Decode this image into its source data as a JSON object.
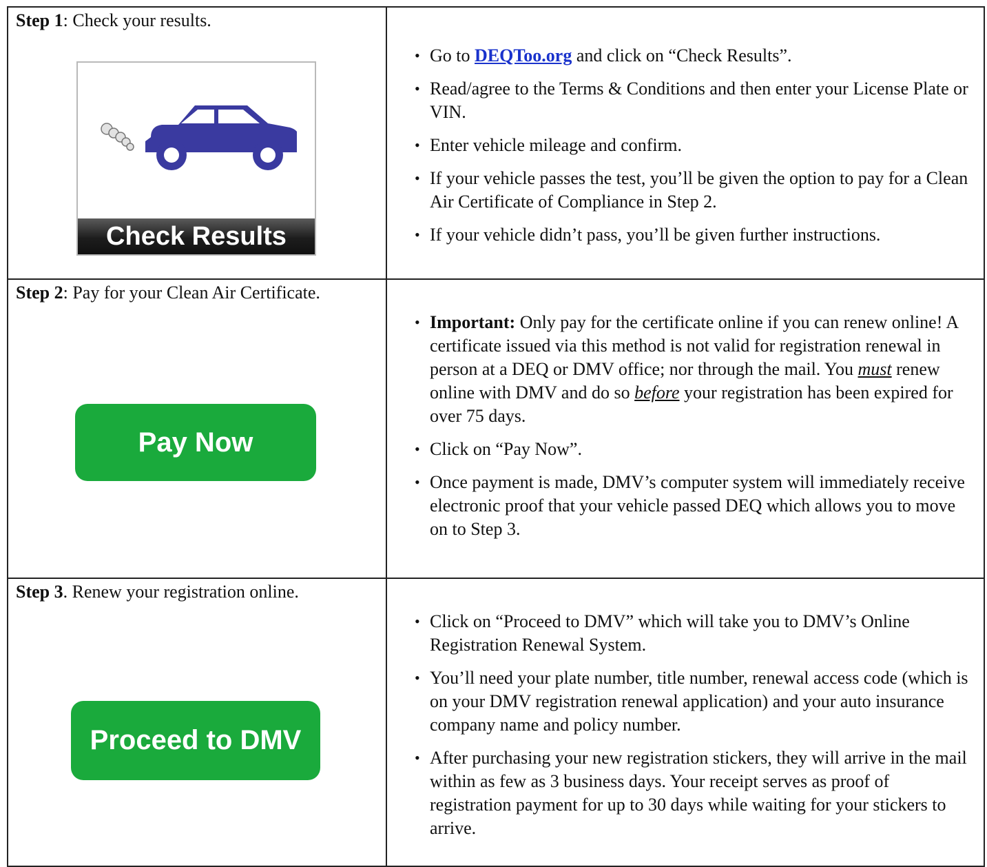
{
  "step1": {
    "heading_bold": "Step 1",
    "heading_rest": ": Check your results.",
    "card_label": "Check Results",
    "bullets": {
      "b1_pre": "Go to ",
      "b1_link": "DEQToo.org",
      "b1_post": " and click on “Check Results”.",
      "b2": "Read/agree to the Terms & Conditions and then enter your License Plate or VIN.",
      "b3": "Enter vehicle mileage and confirm.",
      "b4": "If your vehicle passes the test, you’ll be given the option to pay for a Clean Air Certificate of Compliance in Step 2.",
      "b5": "If your vehicle didn’t pass, you’ll be given further instructions."
    }
  },
  "step2": {
    "heading_bold": "Step 2",
    "heading_rest": ": Pay for your Clean Air Certificate.",
    "button_label": "Pay Now",
    "bullets": {
      "b1_bold": "Important:",
      "b1_a": " Only pay for the certificate online if you can renew online!  A certificate issued via this method is not valid for registration renewal in person at a DEQ or DMV office; nor through the mail.  You ",
      "b1_must": "must",
      "b1_b": " renew online with DMV and do so ",
      "b1_before": "before",
      "b1_c": " your registration has been expired for over 75 days.",
      "b2": "Click on “Pay Now”.",
      "b3": "Once payment is made, DMV’s computer system will immediately receive electronic proof that your vehicle passed DEQ which allows you to move on to Step 3."
    }
  },
  "step3": {
    "heading_bold": "Step 3",
    "heading_rest": ". Renew your registration online.",
    "button_label": "Proceed to DMV",
    "bullets": {
      "b1": "Click on “Proceed to DMV” which will take you to DMV’s Online Registration Renewal System.",
      "b2": "You’ll need your plate number, title number, renewal access code (which is on your DMV registration renewal application) and your auto insurance company name and policy number.",
      "b3": "After purchasing your new registration stickers, they will arrive in the mail within as few as 3 business days. Your receipt serves as proof of registration payment for up to 30 days while waiting for your stickers to arrive."
    }
  },
  "colors": {
    "button_green": "#1aaa3c",
    "link_blue": "#1a33cc",
    "car_blue": "#3a3aa0"
  },
  "icons": {
    "car": "car-icon",
    "exhaust": "exhaust-smoke-icon"
  }
}
